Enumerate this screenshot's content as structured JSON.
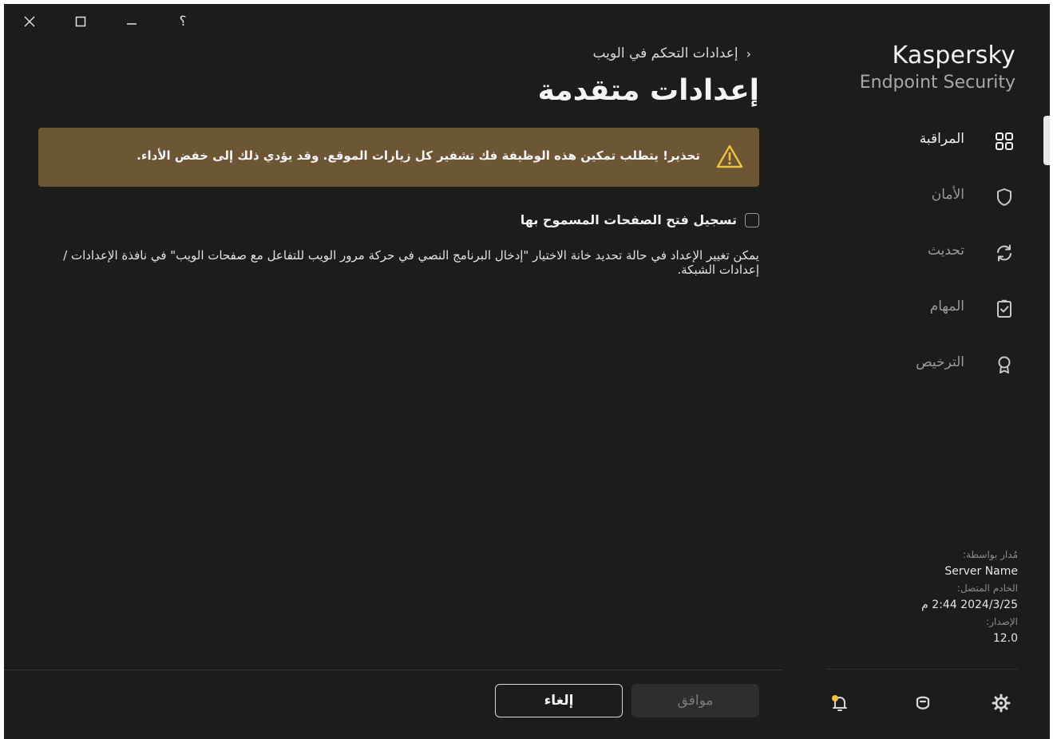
{
  "titlebar": {
    "close_icon": "close-icon",
    "maximize_icon": "maximize-icon",
    "minimize_icon": "minimize-icon",
    "help_label": "؟"
  },
  "brand": {
    "name": "Kaspersky",
    "product": "Endpoint Security"
  },
  "sidebar": {
    "items": [
      {
        "label": "المراقبة",
        "icon": "dashboard-grid-icon",
        "active": true
      },
      {
        "label": "الأمان",
        "icon": "shield-icon",
        "active": false
      },
      {
        "label": "تحديث",
        "icon": "refresh-icon",
        "active": false
      },
      {
        "label": "المهام",
        "icon": "clipboard-check-icon",
        "active": false
      },
      {
        "label": "الترخيص",
        "icon": "license-ribbon-icon",
        "active": false
      }
    ],
    "info": {
      "managed_by_label": "مُدار بواسطة:",
      "managed_by_value": "Server Name",
      "connected_server_label": "الخادم المتصل:",
      "connected_server_value": "2024/3/25 2:44 م",
      "version_label": "الإصدار:",
      "version_value": "12.0"
    },
    "footer_icons": [
      "notifications-bell-icon",
      "support-icon",
      "settings-gear-icon"
    ]
  },
  "main": {
    "breadcrumb": "إعدادات التحكم في الويب",
    "title": "إعدادات متقدمة",
    "warning": "تحذير! يتطلب تمكين هذه الوظيفة فك تشفير كل زيارات الموقع. وقد يؤدي ذلك إلى خفض الأداء.",
    "checkbox_label": "تسجيل فتح الصفحات المسموح بها",
    "checkbox_checked": false,
    "hint": "يمكن تغيير الإعداد في حالة تحديد خانة الاختيار \"إدخال البرنامج النصي في حركة مرور الويب للتفاعل مع صفحات الويب\" في نافذة الإعدادات / إعدادات الشبكة."
  },
  "footer": {
    "ok_label": "موافق",
    "cancel_label": "إلغاء"
  },
  "colors": {
    "background": "#1c1c1c",
    "warning_bg": "#6c5634",
    "warning_icon": "#f0c040",
    "notification_dot": "#f0c040"
  }
}
